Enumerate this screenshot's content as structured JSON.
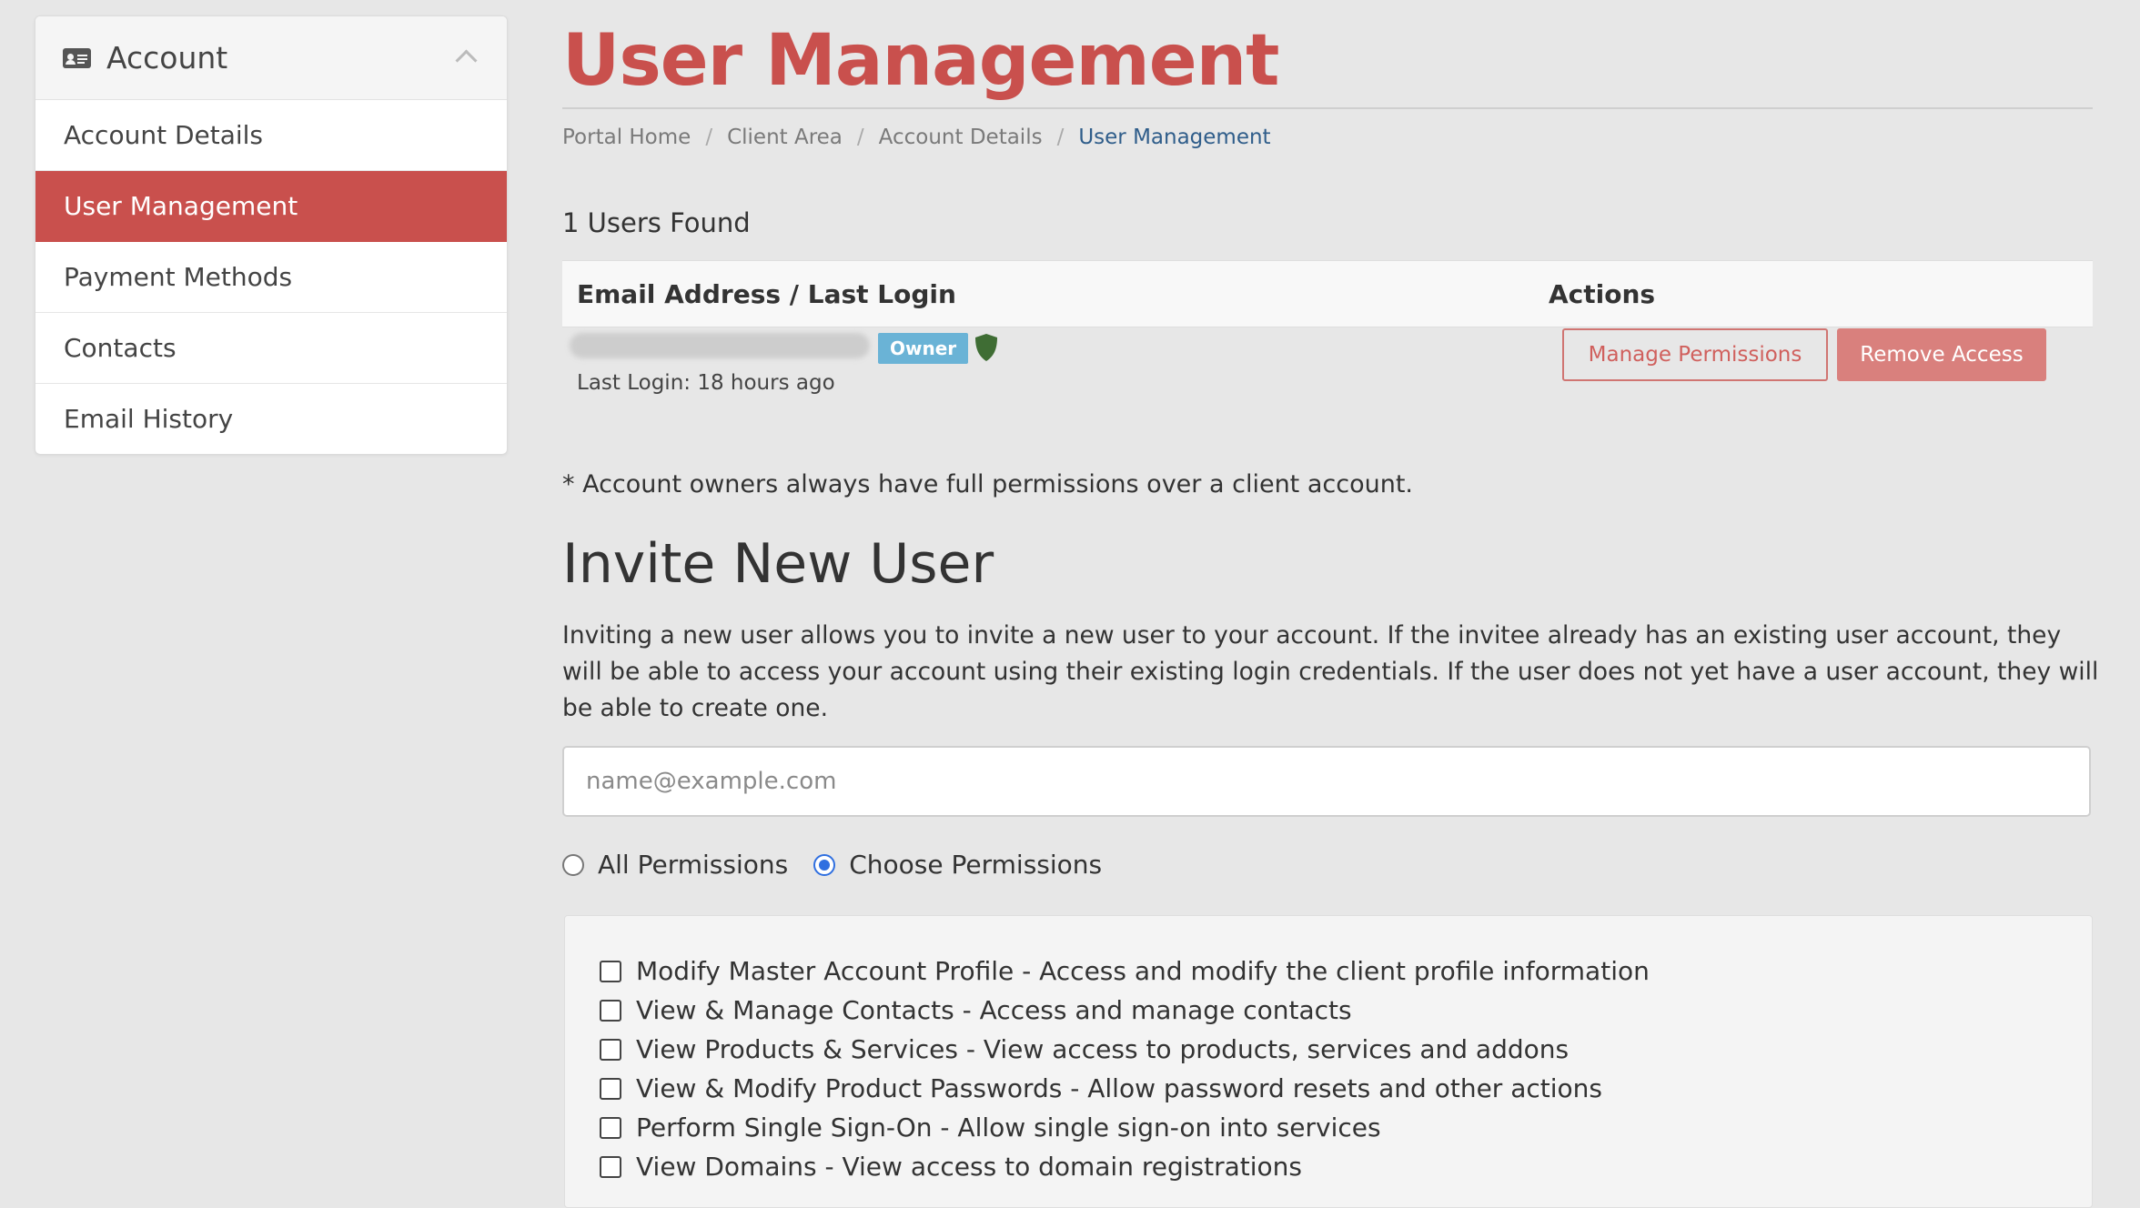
{
  "sidebar": {
    "title": "Account",
    "items": [
      {
        "label": "Account Details"
      },
      {
        "label": "User Management",
        "active": true
      },
      {
        "label": "Payment Methods"
      },
      {
        "label": "Contacts"
      },
      {
        "label": "Email History"
      }
    ]
  },
  "page": {
    "title": "User Management",
    "breadcrumb": [
      "Portal Home",
      "Client Area",
      "Account Details",
      "User Management"
    ]
  },
  "users": {
    "found_text": "1 Users Found",
    "headers": {
      "email": "Email Address / Last Login",
      "actions": "Actions"
    },
    "rows": [
      {
        "badge": "Owner",
        "last_login": "Last Login: 18 hours ago",
        "manage_label": "Manage Permissions",
        "remove_label": "Remove Access"
      }
    ]
  },
  "note": "* Account owners always have full permissions over a client account.",
  "invite": {
    "title": "Invite New User",
    "description": "Inviting a new user allows you to invite a new user to your account. If the invitee already has an existing user account, they will be able to access your account using their existing login credentials. If the user does not yet have a user account, they will be able to create one.",
    "email_placeholder": "name@example.com",
    "email_value": "",
    "radio_all": "All Permissions",
    "radio_choose": "Choose Permissions",
    "selected": "Choose Permissions",
    "permissions": [
      "Modify Master Account Profile - Access and modify the client profile information",
      "View & Manage Contacts - Access and manage contacts",
      "View Products & Services - View access to products, services and addons",
      "View & Modify Product Passwords - Allow password resets and other actions",
      "Perform Single Sign-On - Allow single sign-on into services",
      "View Domains - View access to domain registrations"
    ]
  },
  "colors": {
    "accent": "#c9504d",
    "owner_badge": "#6ab3d6",
    "shield": "#3f6d34",
    "link": "#2f5d8a",
    "radio_checked": "#2f6fe0"
  }
}
